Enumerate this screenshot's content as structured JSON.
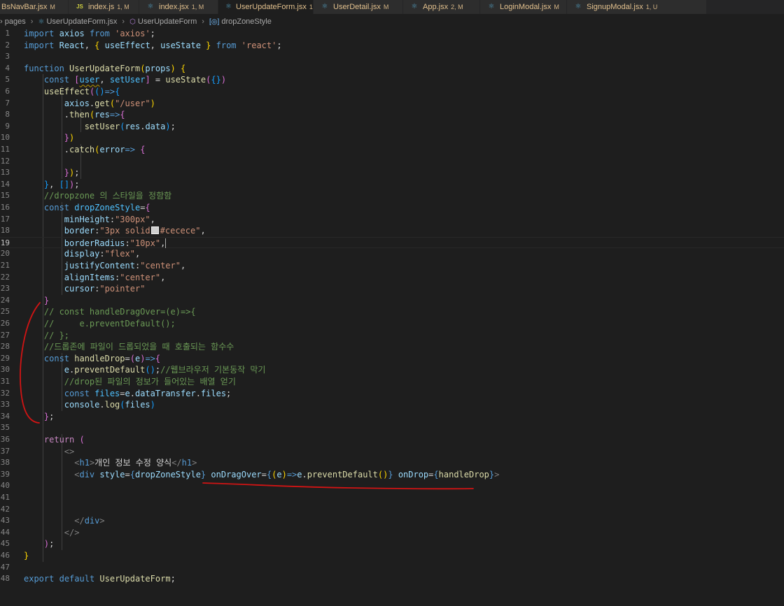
{
  "tabs": [
    {
      "icon": "react",
      "name": "BsNavBar.jsx",
      "badge": "M",
      "color": "#e2c08d",
      "active": false
    },
    {
      "icon": "js",
      "name": "index.js",
      "badge": "1, M",
      "color": "#e2c08d",
      "active": false
    },
    {
      "icon": "react",
      "name": "index.jsx",
      "badge": "1, M",
      "color": "#e2c08d",
      "active": false
    },
    {
      "icon": "react",
      "name": "UserUpdateForm.jsx",
      "badge": "1, U",
      "color": "#e2c08d",
      "active": true
    },
    {
      "icon": "react",
      "name": "UserDetail.jsx",
      "badge": "M",
      "color": "#e2c08d",
      "active": false
    },
    {
      "icon": "react",
      "name": "App.jsx",
      "badge": "2, M",
      "color": "#e2c08d",
      "active": false
    },
    {
      "icon": "react",
      "name": "LoginModal.jsx",
      "badge": "M",
      "color": "#e2c08d",
      "active": false
    },
    {
      "icon": "react",
      "name": "SignupModal.jsx",
      "badge": "1, U",
      "color": "#e2c08d",
      "active": false
    }
  ],
  "tab_close_glyph": "×",
  "breadcrumb": {
    "folder": "pages",
    "file": "UserUpdateForm.jsx",
    "component": "UserUpdateForm",
    "symbol": "dropZoneStyle"
  },
  "current_line": 19,
  "lines": [
    [
      [
        "kw",
        "import"
      ],
      [
        "punc",
        " "
      ],
      [
        "var",
        "axios"
      ],
      [
        "punc",
        " "
      ],
      [
        "kw",
        "from"
      ],
      [
        "punc",
        " "
      ],
      [
        "str",
        "'axios'"
      ],
      [
        "punc",
        ";"
      ]
    ],
    [
      [
        "kw",
        "import"
      ],
      [
        "punc",
        " "
      ],
      [
        "var",
        "React"
      ],
      [
        "punc",
        ", "
      ],
      [
        "b1",
        "{"
      ],
      [
        "punc",
        " "
      ],
      [
        "var",
        "useEffect"
      ],
      [
        "punc",
        ", "
      ],
      [
        "var",
        "useState"
      ],
      [
        "punc",
        " "
      ],
      [
        "b1",
        "}"
      ],
      [
        "punc",
        " "
      ],
      [
        "kw",
        "from"
      ],
      [
        "punc",
        " "
      ],
      [
        "str",
        "'react'"
      ],
      [
        "punc",
        ";"
      ]
    ],
    [],
    [
      [
        "kw",
        "function"
      ],
      [
        "punc",
        " "
      ],
      [
        "fn",
        "UserUpdateForm"
      ],
      [
        "b1",
        "("
      ],
      [
        "var",
        "props"
      ],
      [
        "b1",
        ")"
      ],
      [
        "punc",
        " "
      ],
      [
        "b1",
        "{"
      ]
    ],
    [
      [
        "punc",
        "    "
      ],
      [
        "kw",
        "const"
      ],
      [
        "punc",
        " "
      ],
      [
        "b2",
        "["
      ],
      [
        "cst squig",
        "user"
      ],
      [
        "punc",
        ", "
      ],
      [
        "cst",
        "setUser"
      ],
      [
        "b2",
        "]"
      ],
      [
        "punc",
        " = "
      ],
      [
        "fn",
        "useState"
      ],
      [
        "b2",
        "("
      ],
      [
        "b3",
        "{}"
      ],
      [
        "b2",
        ")"
      ]
    ],
    [
      [
        "punc",
        "    "
      ],
      [
        "fn",
        "useEffect"
      ],
      [
        "b2",
        "("
      ],
      [
        "b3",
        "()"
      ],
      [
        "kw",
        "=>"
      ],
      [
        "b3",
        "{"
      ]
    ],
    [
      [
        "punc",
        "        "
      ],
      [
        "var",
        "axios"
      ],
      [
        "punc",
        "."
      ],
      [
        "fn",
        "get"
      ],
      [
        "b1",
        "("
      ],
      [
        "str",
        "\"/user\""
      ],
      [
        "b1",
        ")"
      ]
    ],
    [
      [
        "punc",
        "        ."
      ],
      [
        "fn",
        "then"
      ],
      [
        "b1",
        "("
      ],
      [
        "var",
        "res"
      ],
      [
        "kw",
        "=>"
      ],
      [
        "b2",
        "{"
      ]
    ],
    [
      [
        "punc",
        "            "
      ],
      [
        "fn",
        "setUser"
      ],
      [
        "b3",
        "("
      ],
      [
        "var",
        "res"
      ],
      [
        "punc",
        "."
      ],
      [
        "var",
        "data"
      ],
      [
        "b3",
        ")"
      ],
      [
        "punc",
        ";"
      ]
    ],
    [
      [
        "punc",
        "        "
      ],
      [
        "b2",
        "}"
      ],
      [
        "b1",
        ")"
      ]
    ],
    [
      [
        "punc",
        "        ."
      ],
      [
        "fn",
        "catch"
      ],
      [
        "b1",
        "("
      ],
      [
        "var",
        "error"
      ],
      [
        "kw",
        "=>"
      ],
      [
        "punc",
        " "
      ],
      [
        "b2",
        "{"
      ]
    ],
    [],
    [
      [
        "punc",
        "        "
      ],
      [
        "b2",
        "}"
      ],
      [
        "b1",
        ")"
      ],
      [
        "punc",
        ";"
      ]
    ],
    [
      [
        "punc",
        "    "
      ],
      [
        "b3",
        "}"
      ],
      [
        "punc",
        ", "
      ],
      [
        "b3",
        "[]"
      ],
      [
        "b2",
        ")"
      ],
      [
        "punc",
        ";"
      ]
    ],
    [
      [
        "punc",
        "    "
      ],
      [
        "cmt",
        "//dropzone 의 스타일을 정함함"
      ]
    ],
    [
      [
        "punc",
        "    "
      ],
      [
        "kw",
        "const"
      ],
      [
        "punc",
        " "
      ],
      [
        "cst",
        "dropZoneStyle"
      ],
      [
        "punc",
        "="
      ],
      [
        "b2",
        "{"
      ]
    ],
    [
      [
        "punc",
        "        "
      ],
      [
        "var",
        "minHeight"
      ],
      [
        "punc",
        ":"
      ],
      [
        "str",
        "\"300px\""
      ],
      [
        "punc",
        ","
      ]
    ],
    [
      [
        "punc",
        "        "
      ],
      [
        "var",
        "border"
      ],
      [
        "punc",
        ":"
      ],
      [
        "str",
        "\"3px solid"
      ],
      [
        "swatch",
        ""
      ],
      [
        "str",
        "#cecece\""
      ],
      [
        "punc",
        ","
      ]
    ],
    [
      [
        "punc",
        "        "
      ],
      [
        "var",
        "borderRadius"
      ],
      [
        "punc",
        ":"
      ],
      [
        "str",
        "\"10px\""
      ],
      [
        "punc",
        ","
      ],
      [
        "caret",
        ""
      ]
    ],
    [
      [
        "punc",
        "        "
      ],
      [
        "var",
        "display"
      ],
      [
        "punc",
        ":"
      ],
      [
        "str",
        "\"flex\""
      ],
      [
        "punc",
        ","
      ]
    ],
    [
      [
        "punc",
        "        "
      ],
      [
        "var",
        "justifyContent"
      ],
      [
        "punc",
        ":"
      ],
      [
        "str",
        "\"center\""
      ],
      [
        "punc",
        ","
      ]
    ],
    [
      [
        "punc",
        "        "
      ],
      [
        "var",
        "alignItems"
      ],
      [
        "punc",
        ":"
      ],
      [
        "str",
        "\"center\""
      ],
      [
        "punc",
        ","
      ]
    ],
    [
      [
        "punc",
        "        "
      ],
      [
        "var",
        "cursor"
      ],
      [
        "punc",
        ":"
      ],
      [
        "str",
        "\"pointer\""
      ]
    ],
    [
      [
        "punc",
        "    "
      ],
      [
        "b2",
        "}"
      ]
    ],
    [
      [
        "punc",
        "    "
      ],
      [
        "cmt",
        "// const handleDragOver=(e)=>{"
      ]
    ],
    [
      [
        "punc",
        "    "
      ],
      [
        "cmt",
        "//     e.preventDefault();"
      ]
    ],
    [
      [
        "punc",
        "    "
      ],
      [
        "cmt",
        "// };"
      ]
    ],
    [
      [
        "punc",
        "    "
      ],
      [
        "cmt",
        "//드롭존에 파일이 드롭되었을 때 호출되는 함수수"
      ]
    ],
    [
      [
        "punc",
        "    "
      ],
      [
        "kw",
        "const"
      ],
      [
        "punc",
        " "
      ],
      [
        "fn",
        "handleDrop"
      ],
      [
        "punc",
        "="
      ],
      [
        "b2",
        "("
      ],
      [
        "var",
        "e"
      ],
      [
        "b2",
        ")"
      ],
      [
        "kw",
        "=>"
      ],
      [
        "b2",
        "{"
      ]
    ],
    [
      [
        "punc",
        "        "
      ],
      [
        "var",
        "e"
      ],
      [
        "punc",
        "."
      ],
      [
        "fn",
        "preventDefault"
      ],
      [
        "b3",
        "()"
      ],
      [
        "punc",
        ";"
      ],
      [
        "cmt",
        "//웹브라우저 기본동작 막기"
      ]
    ],
    [
      [
        "punc",
        "        "
      ],
      [
        "cmt",
        "//drop된 파일의 정보가 들어있는 배열 얻기"
      ]
    ],
    [
      [
        "punc",
        "        "
      ],
      [
        "kw",
        "const"
      ],
      [
        "punc",
        " "
      ],
      [
        "cst",
        "files"
      ],
      [
        "punc",
        "="
      ],
      [
        "var",
        "e"
      ],
      [
        "punc",
        "."
      ],
      [
        "var",
        "dataTransfer"
      ],
      [
        "punc",
        "."
      ],
      [
        "var",
        "files"
      ],
      [
        "punc",
        ";"
      ]
    ],
    [
      [
        "punc",
        "        "
      ],
      [
        "var",
        "console"
      ],
      [
        "punc",
        "."
      ],
      [
        "fn",
        "log"
      ],
      [
        "b3",
        "("
      ],
      [
        "var",
        "files"
      ],
      [
        "b3",
        ")"
      ]
    ],
    [
      [
        "punc",
        "    "
      ],
      [
        "b2",
        "}"
      ],
      [
        "punc",
        ";"
      ]
    ],
    [],
    [
      [
        "punc",
        "    "
      ],
      [
        "ctl",
        "return"
      ],
      [
        "punc",
        " "
      ],
      [
        "b2",
        "("
      ]
    ],
    [
      [
        "punc",
        "        "
      ],
      [
        "tagp",
        "<>"
      ]
    ],
    [
      [
        "punc",
        "          "
      ],
      [
        "tagp",
        "<"
      ],
      [
        "tag",
        "h1"
      ],
      [
        "tagp",
        ">"
      ],
      [
        "punc",
        "개인 정보 수정 양식"
      ],
      [
        "tagp",
        "</"
      ],
      [
        "tag",
        "h1"
      ],
      [
        "tagp",
        ">"
      ]
    ],
    [
      [
        "punc",
        "          "
      ],
      [
        "tagp",
        "<"
      ],
      [
        "tag",
        "div"
      ],
      [
        "punc",
        " "
      ],
      [
        "attr",
        "style"
      ],
      [
        "punc",
        "="
      ],
      [
        "kw",
        "{"
      ],
      [
        "var",
        "dropZoneStyle"
      ],
      [
        "kw",
        "}"
      ],
      [
        "punc",
        " "
      ],
      [
        "attr",
        "onDragOver"
      ],
      [
        "punc",
        "="
      ],
      [
        "kw",
        "{"
      ],
      [
        "b1",
        "("
      ],
      [
        "var",
        "e"
      ],
      [
        "b1",
        ")"
      ],
      [
        "kw",
        "=>"
      ],
      [
        "var",
        "e"
      ],
      [
        "punc",
        "."
      ],
      [
        "fn",
        "preventDefault"
      ],
      [
        "b1",
        "()"
      ],
      [
        "kw",
        "}"
      ],
      [
        "punc",
        " "
      ],
      [
        "attr",
        "onDrop"
      ],
      [
        "punc",
        "="
      ],
      [
        "kw",
        "{"
      ],
      [
        "fn",
        "handleDrop"
      ],
      [
        "kw",
        "}"
      ],
      [
        "tagp",
        ">"
      ]
    ],
    [],
    [],
    [],
    [
      [
        "punc",
        "          "
      ],
      [
        "tagp",
        "</"
      ],
      [
        "tag",
        "div"
      ],
      [
        "tagp",
        ">"
      ]
    ],
    [
      [
        "punc",
        "        "
      ],
      [
        "tagp",
        "</>"
      ]
    ],
    [
      [
        "punc",
        "    "
      ],
      [
        "b2",
        ")"
      ],
      [
        "punc",
        ";"
      ]
    ],
    [
      [
        "b1",
        "}"
      ]
    ],
    [],
    [
      [
        "kw",
        "export"
      ],
      [
        "punc",
        " "
      ],
      [
        "kw",
        "default"
      ],
      [
        "punc",
        " "
      ],
      [
        "fn",
        "UserUpdateForm"
      ],
      [
        "punc",
        ";"
      ]
    ]
  ]
}
